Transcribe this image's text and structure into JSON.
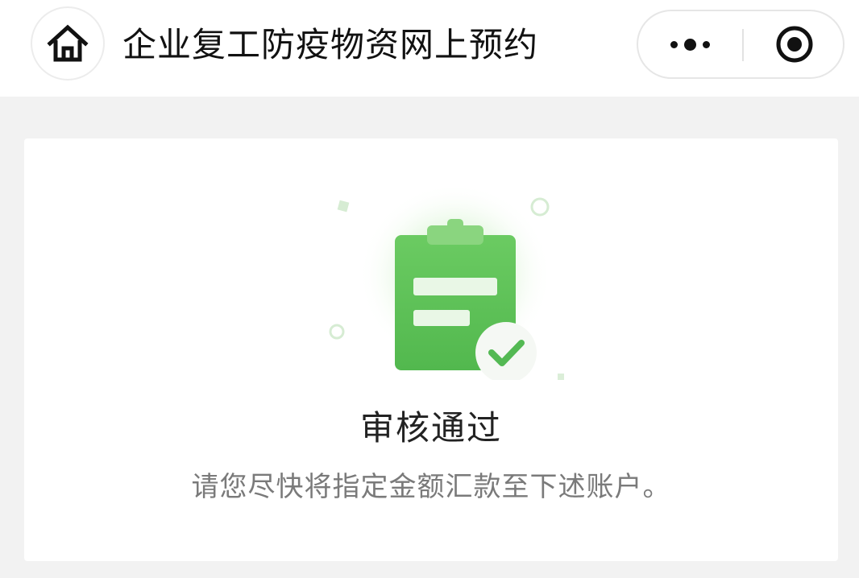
{
  "header": {
    "title": "企业复工防疫物资网上预约",
    "home_icon": "home-icon",
    "more_icon": "more-dots-icon",
    "close_icon": "close-miniprogram-icon"
  },
  "result": {
    "title": "审核通过",
    "description": "请您尽快将指定金额汇款至下述账户。",
    "icon": "clipboard-check-icon"
  },
  "colors": {
    "accent_green": "#5cc25a",
    "check_green": "#53b953",
    "background": "#f2f2f2",
    "card": "#ffffff"
  }
}
